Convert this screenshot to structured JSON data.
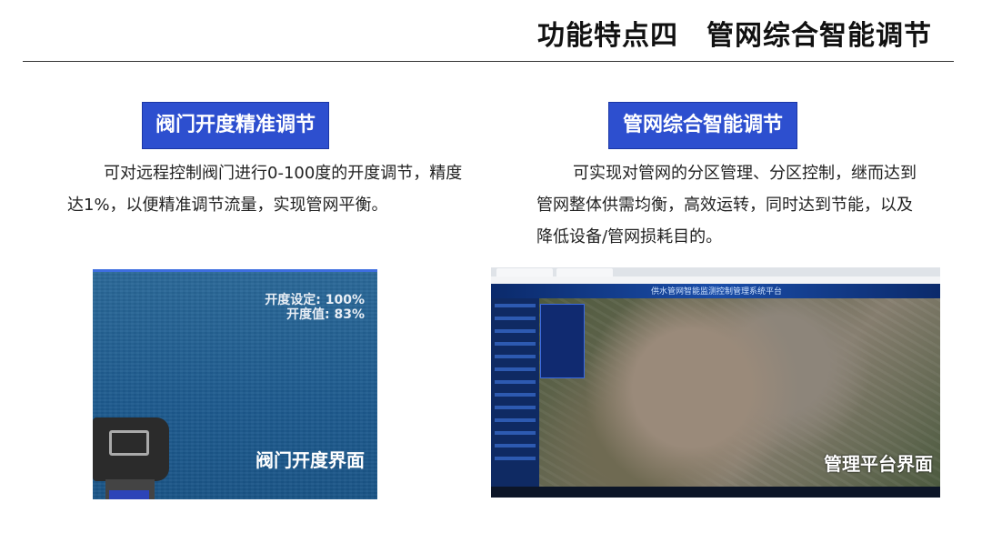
{
  "slide": {
    "title": "功能特点四　管网综合智能调节"
  },
  "left": {
    "heading": "阀门开度精准调节",
    "paragraph": "可对远程控制阀门进行0-100度的开度调节，精度达1%，以便精准调节流量，实现管网平衡。",
    "image": {
      "setpoint": "开度设定: 100%",
      "value": "开度值: 83%",
      "caption": "阀门开度界面"
    }
  },
  "right": {
    "heading": "管网综合智能调节",
    "paragraph": "可实现对管网的分区管理、分区控制，继而达到管网整体供需均衡，高效运转，同时达到节能，以及降低设备/管网损耗目的。",
    "image": {
      "header_title": "供水管网智能监测控制管理系统平台",
      "caption": "管理平台界面"
    }
  }
}
